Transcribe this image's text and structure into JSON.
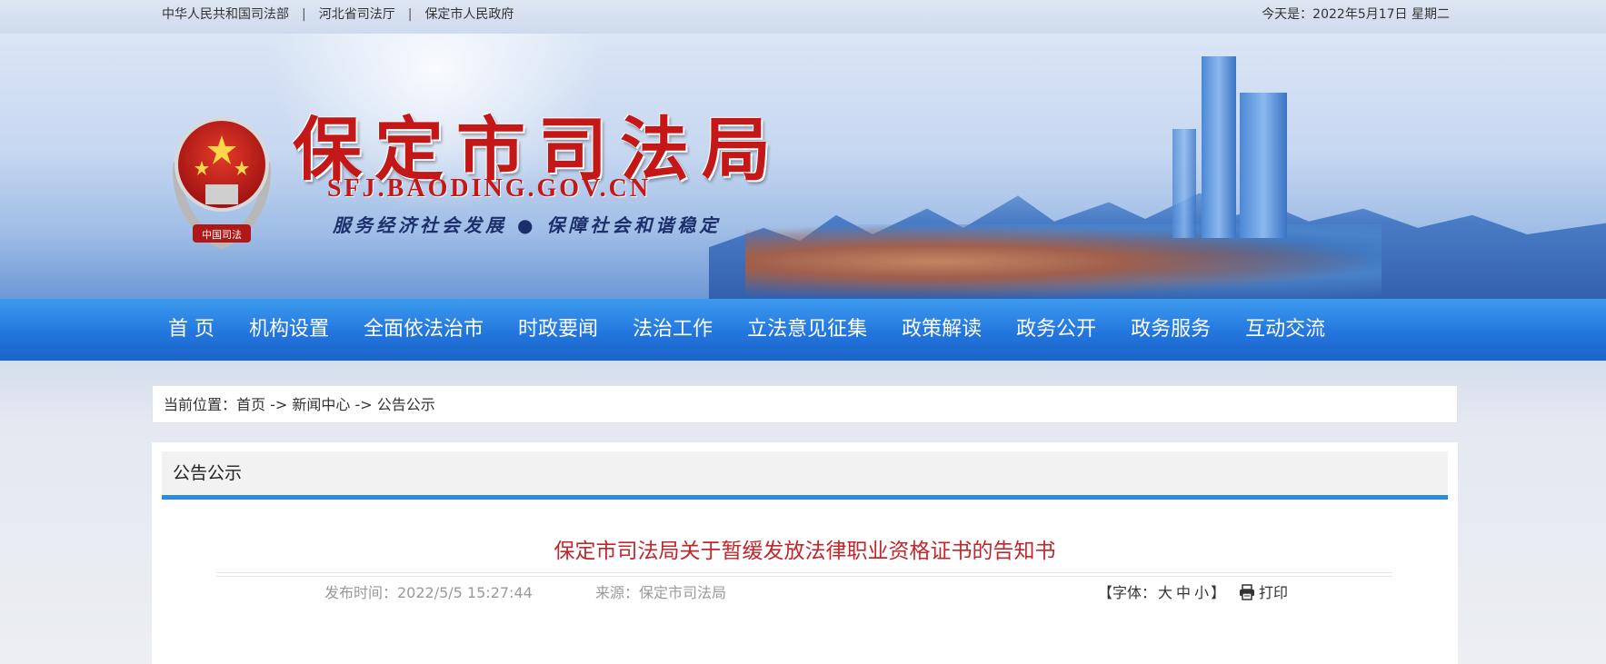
{
  "topbar": {
    "links": [
      "中华人民共和国司法部",
      "河北省司法厅",
      "保定市人民政府"
    ],
    "separator": "|",
    "date": "今天是：2022年5月17日 星期二"
  },
  "banner": {
    "title": "保定市司法局",
    "domain": "SFJ.BAODING.GOV.CN",
    "slogan": "服务经济社会发展 ● 保障社会和谐稳定",
    "emblem_text": "中国司法"
  },
  "nav": {
    "items": [
      "首 页",
      "机构设置",
      "全面依法治市",
      "时政要闻",
      "法治工作",
      "立法意见征集",
      "政策解读",
      "政务公开",
      "政务服务",
      "互动交流"
    ]
  },
  "breadcrumb": {
    "label": "当前位置：",
    "items": [
      "首页",
      "新闻中心",
      "公告公示"
    ],
    "arrow": " -> "
  },
  "panel": {
    "heading": "公告公示"
  },
  "article": {
    "title": "保定市司法局关于暂缓发放法律职业资格证书的告知书",
    "publish_time": "发布时间：2022/5/5 15:27:44",
    "source": "来源：保定市司法局",
    "font_label_open": "【字体：",
    "font_sizes": [
      "大",
      "中",
      "小"
    ],
    "font_label_close": "】",
    "print_label": "打印"
  },
  "colors": {
    "title_red": "#c41818",
    "nav_blue": "#2376de",
    "article_title_red": "#c0262c",
    "panel_underline": "#2c8be0"
  }
}
